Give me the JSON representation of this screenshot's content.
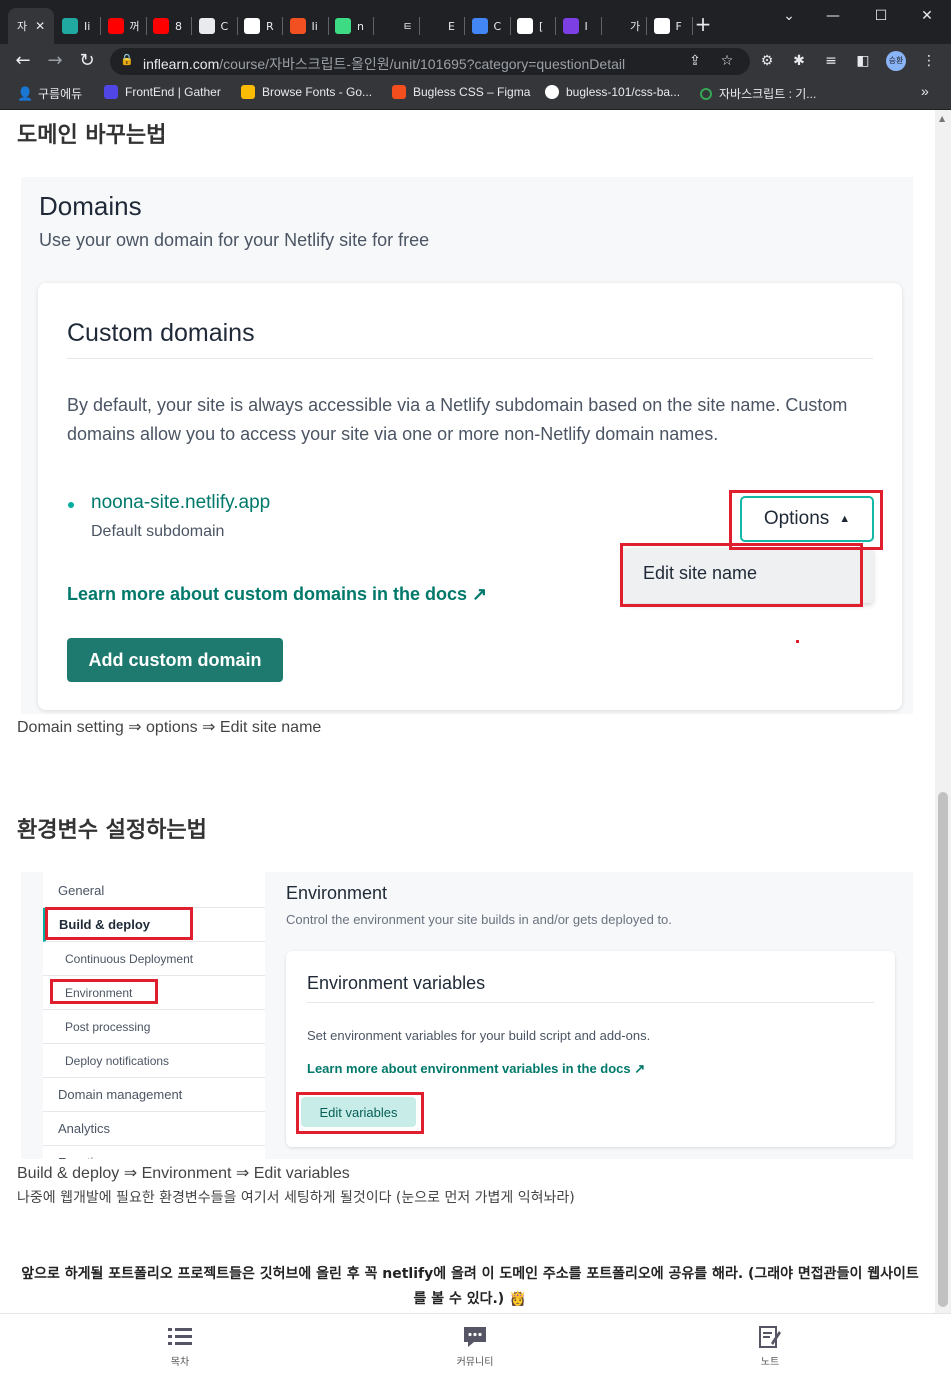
{
  "browser": {
    "tabs": [
      {
        "label": "자",
        "color": "#35363a",
        "active": true
      },
      {
        "label": "Ii",
        "color": "#1fa9a0"
      },
      {
        "label": "꺼",
        "color": "#ff0000"
      },
      {
        "label": "8",
        "color": "#ff0000"
      },
      {
        "label": "C",
        "color": "#e8eaed"
      },
      {
        "label": "R",
        "color": "#ffffff"
      },
      {
        "label": "Ii",
        "color": "#f25022"
      },
      {
        "label": "n",
        "color": "#3ddc84"
      },
      {
        "label": "ㅌ",
        "color": "#202124"
      },
      {
        "label": "E",
        "color": "#202124"
      },
      {
        "label": "C",
        "color": "#4285f4"
      },
      {
        "label": "[",
        "color": "#ffffff"
      },
      {
        "label": "I",
        "color": "#7b3fe4"
      },
      {
        "label": "가",
        "color": "#202124"
      },
      {
        "label": "F",
        "color": "#ffffff"
      }
    ],
    "close_tab": "✕",
    "new_tab": "+",
    "window": {
      "minimize": "—",
      "maximize": "☐",
      "close": "✕",
      "dropdown": "⌄"
    },
    "nav": {
      "back": "←",
      "forward": "→",
      "reload": "↻"
    },
    "url_host": "inflearn.com",
    "url_path": "/course/자바스크립트-올인원/unit/101695?category=questionDetail",
    "lock_icon": "🔒",
    "extensions": [
      "⇪",
      "☆",
      "⚙",
      "✱",
      "≡",
      "◧",
      "⋮"
    ],
    "profile": "승환",
    "bookmarks": [
      {
        "label": "구름에듀",
        "icon_color": "#ffffff"
      },
      {
        "label": "FrontEnd | Gather",
        "icon_color": "#4f46e5"
      },
      {
        "label": "Browse Fonts - Go...",
        "icon_color": "#fbbc04"
      },
      {
        "label": "Bugless CSS – Figma",
        "icon_color": "#f24e1e"
      },
      {
        "label": "bugless-101/css-ba...",
        "icon_color": "#ffffff"
      },
      {
        "label": "자바스크립트 : 기...",
        "icon_color": "#34a853"
      }
    ],
    "bookmarks_more": "»"
  },
  "article": {
    "section1_heading": "도메인 바꾸는법",
    "domains_screenshot": {
      "title": "Domains",
      "subtitle": "Use your own domain for your Netlify site for free",
      "card_title": "Custom domains",
      "card_desc": "By default, your site is always accessible via a Netlify subdomain based on the site name. Custom domains allow you to access your site via one or more non-Netlify domain names.",
      "site_link": "noona-site.netlify.app",
      "site_sub": "Default subdomain",
      "learn_link": "Learn more about custom domains in the docs ↗",
      "add_button": "Add custom domain",
      "options_button": "Options",
      "menu_item": "Edit site name",
      "highlight_color": "#e01f2e",
      "accent_color": "#00796b"
    },
    "caption1": "Domain setting ⇒ options ⇒ Edit site name",
    "section2_heading": "환경변수 설정하는법",
    "env_screenshot": {
      "sidebar": [
        {
          "label": "General",
          "level": "top"
        },
        {
          "label": "Build & deploy",
          "level": "top",
          "active": true
        },
        {
          "label": "Continuous Deployment",
          "level": "sub"
        },
        {
          "label": "Environment",
          "level": "sub"
        },
        {
          "label": "Post processing",
          "level": "sub"
        },
        {
          "label": "Deploy notifications",
          "level": "sub"
        },
        {
          "label": "Domain management",
          "level": "top"
        },
        {
          "label": "Analytics",
          "level": "top"
        },
        {
          "label": "Functions",
          "level": "top"
        }
      ],
      "title": "Environment",
      "subtitle": "Control the environment your site builds in and/or gets deployed to.",
      "card_title": "Environment variables",
      "card_desc": "Set environment variables for your build script and add-ons.",
      "card_link": "Learn more about environment variables in the docs ↗",
      "edit_button": "Edit variables"
    },
    "caption2": "Build & deploy ⇒ Environment ⇒ Edit variables",
    "note": "나중에 웹개발에 필요한 환경변수들을 여기서 세팅하게 될것이다 (눈으로 먼저 가볍게 익혀놔라)",
    "bold_paragraph": "앞으로 하게될 포트폴리오 프로젝트들은 깃허브에 올린 후 꼭 netlify에 올려 이 도메인 주소를 포트폴리오에 공유를 해라. (그래야 면접관들이 웹사이트를 볼 수 있다.) 👸"
  },
  "bottom_nav": [
    {
      "label": "목차",
      "icon": "list-icon"
    },
    {
      "label": "커뮤니티",
      "icon": "chat-icon"
    },
    {
      "label": "노트",
      "icon": "note-icon"
    }
  ]
}
